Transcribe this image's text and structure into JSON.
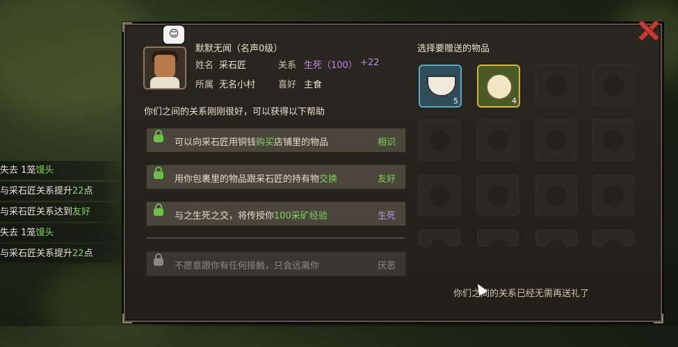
{
  "npc": {
    "title": "默默无闻（名声0级）",
    "name_label": "姓名",
    "name": "采石匠",
    "relation_label": "关系",
    "relation": "生死（100）",
    "relation_delta": "+22",
    "home_label": "所属",
    "home": "无名小村",
    "like_label": "喜好",
    "like": "主食",
    "emote": "😊"
  },
  "help_intro": "你们之间的关系刚刚很好，可以获得以下帮助",
  "help_rows": [
    {
      "a": "可以向采石匠用铜钱",
      "b": "购买",
      "c": "店铺里的物品",
      "level": "相识"
    },
    {
      "a": "用你包裹里的物品跟采石匠的持有物",
      "b": "交换",
      "c": "",
      "level": "友好"
    },
    {
      "a": "与之生死之交，将传授你",
      "b": "100采矿经验",
      "c": "",
      "level": "生死"
    },
    {
      "a": "不愿意跟你有任何接触，只会远离你",
      "b": "",
      "c": "",
      "level": "厌恶"
    }
  ],
  "gift": {
    "title": "选择要赠送的物品",
    "items": [
      {
        "icon": "rice-bowl-icon",
        "count": "5"
      },
      {
        "icon": "steamed-bun-icon",
        "count": "4"
      }
    ],
    "footer": "你们之间的关系已经无需再送礼了"
  },
  "log": [
    {
      "a": "失去 1笼",
      "b": "馒头",
      "c": ""
    },
    {
      "a": "与采石匠关系提升",
      "b": "22",
      "c": "点"
    },
    {
      "a": "与采石匠关系达到",
      "b": "友好",
      "c": ""
    },
    {
      "a": "失去 1笼",
      "b": "馒头",
      "c": ""
    },
    {
      "a": "与采石匠关系提升",
      "b": "22",
      "c": "点"
    }
  ],
  "colors": {
    "accent_green": "#7fd45a",
    "relation_purple": "#c18ae8",
    "close_red": "#c43c36"
  }
}
